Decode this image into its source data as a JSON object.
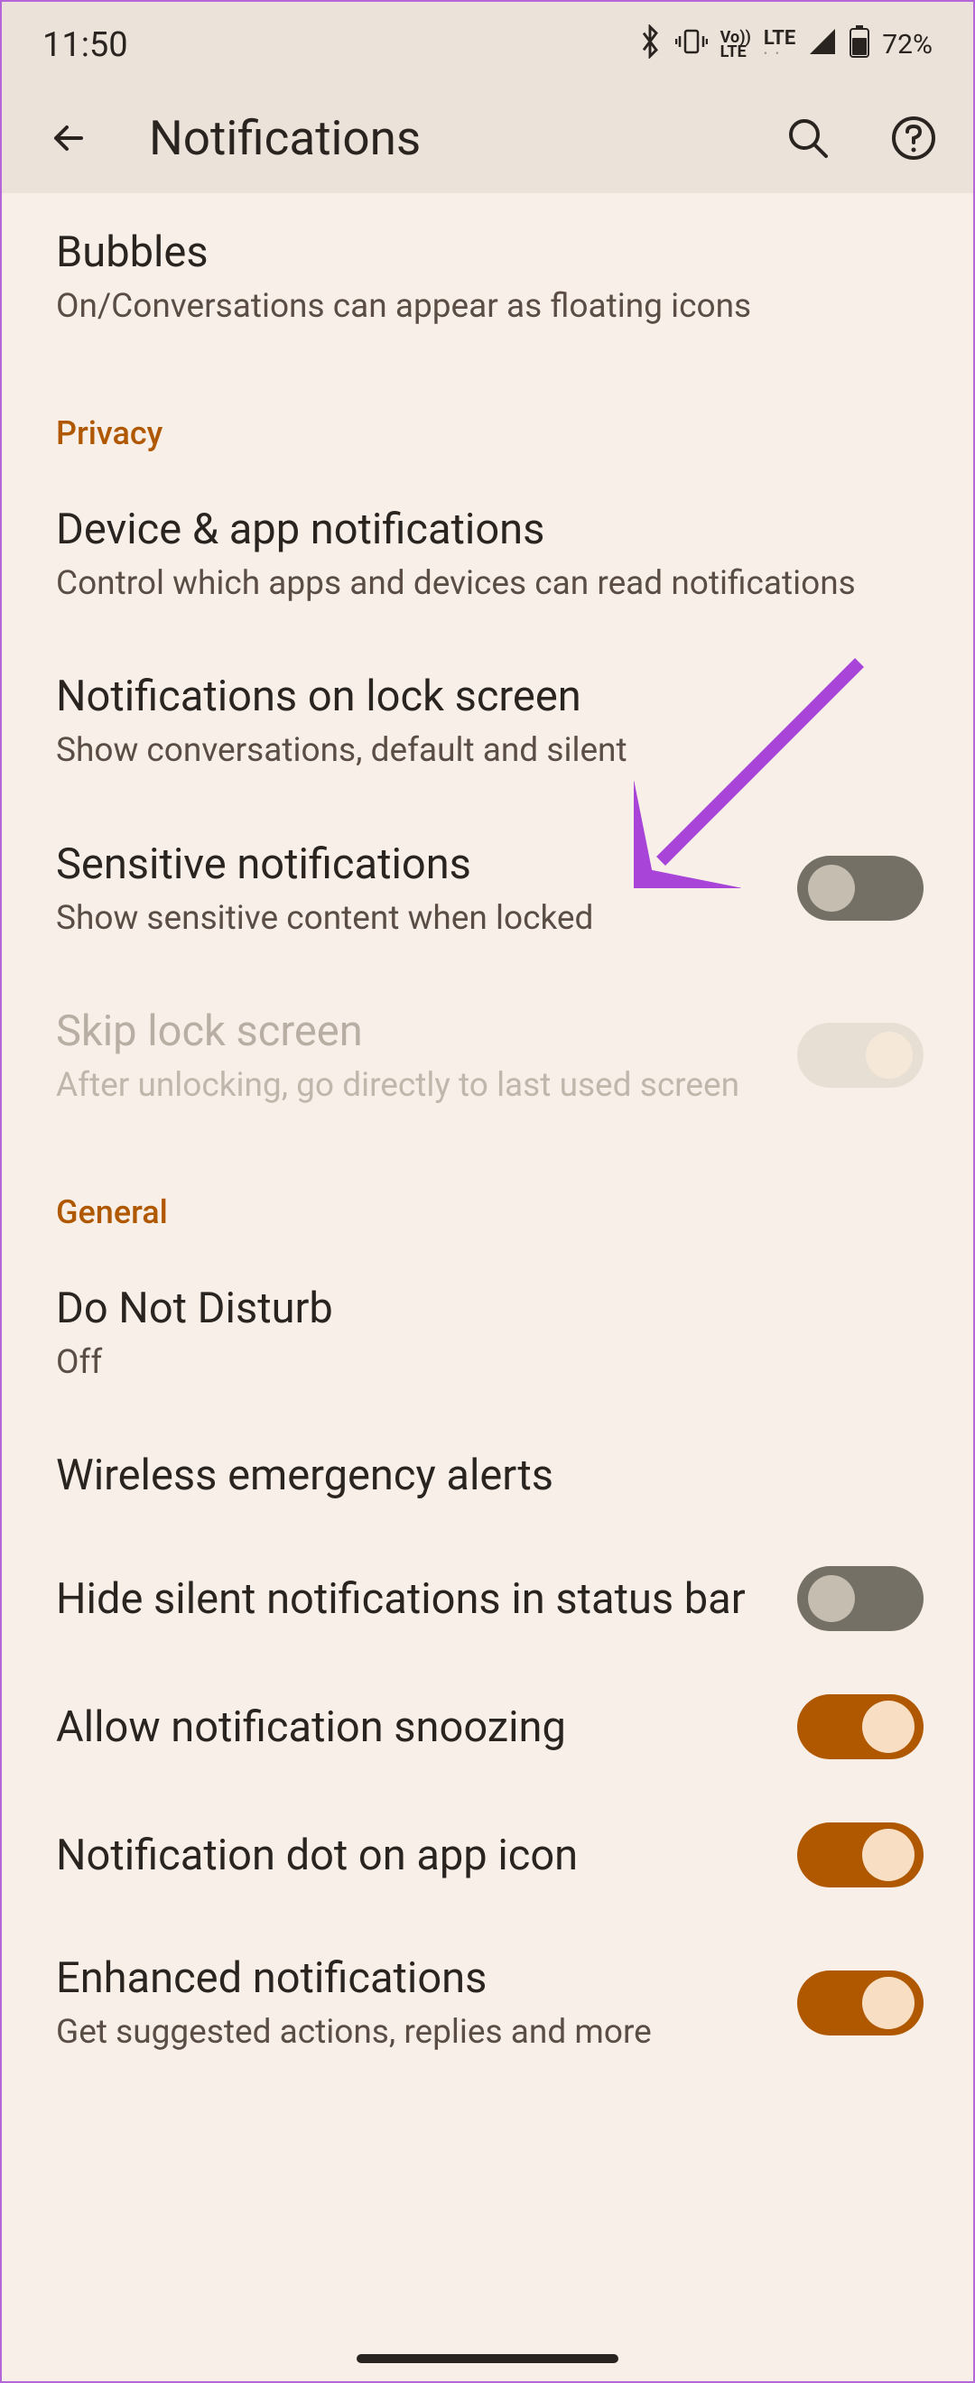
{
  "status": {
    "time": "11:50",
    "battery": "72%"
  },
  "header": {
    "title": "Notifications"
  },
  "items": {
    "bubbles": {
      "title": "Bubbles",
      "desc": "On/Conversations can appear as floating icons"
    }
  },
  "sections": {
    "privacy": {
      "label": "Privacy",
      "items": {
        "device_app": {
          "title": "Device & app notifications",
          "desc": "Control which apps and devices can read notifications"
        },
        "lock_screen": {
          "title": "Notifications on lock screen",
          "desc": "Show conversations, default and silent"
        },
        "sensitive": {
          "title": "Sensitive notifications",
          "desc": "Show sensitive content when locked"
        },
        "skip_lock": {
          "title": "Skip lock screen",
          "desc": "After unlocking, go directly to last used screen"
        }
      }
    },
    "general": {
      "label": "General",
      "items": {
        "dnd": {
          "title": "Do Not Disturb",
          "desc": "Off"
        },
        "wireless": {
          "title": "Wireless emergency alerts"
        },
        "hide_silent": {
          "title": "Hide silent notifications in status bar"
        },
        "snoozing": {
          "title": "Allow notification snoozing"
        },
        "dot": {
          "title": "Notification dot on app icon"
        },
        "enhanced": {
          "title": "Enhanced notifications",
          "desc": "Get suggested actions, replies and more"
        }
      }
    }
  }
}
